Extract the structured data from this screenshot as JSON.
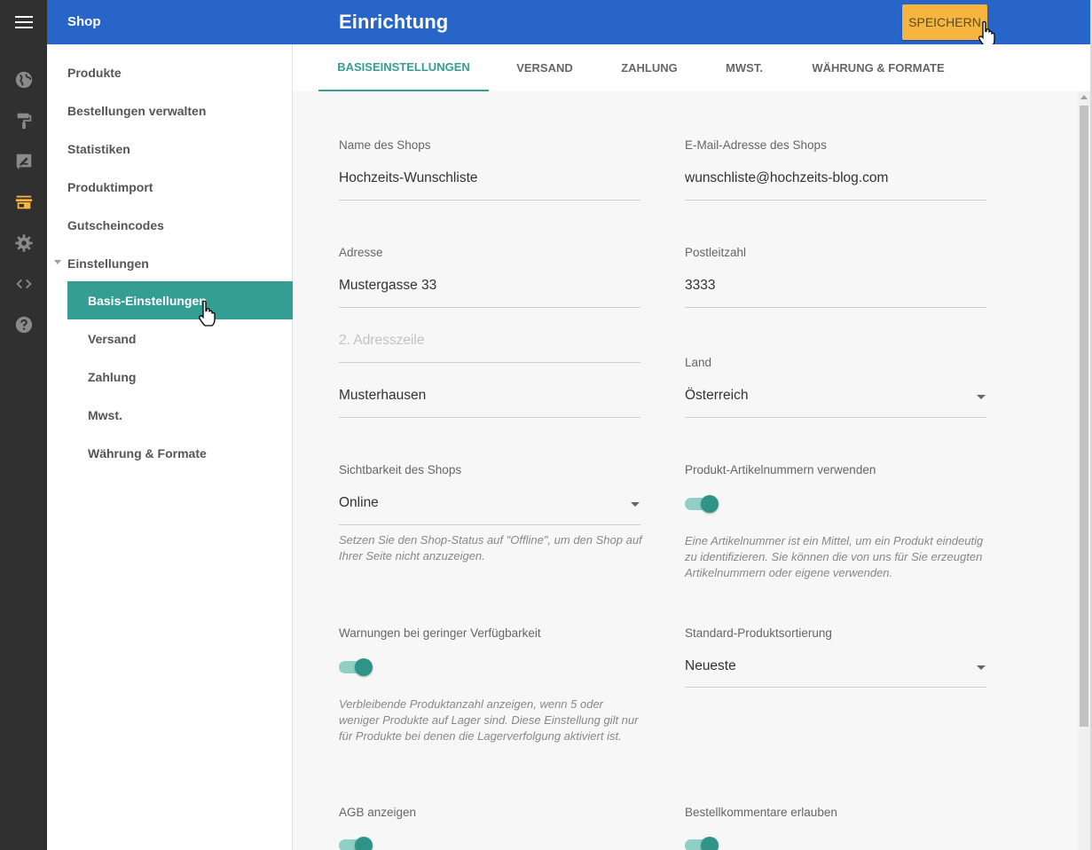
{
  "header": {
    "app_name": "Shop",
    "page_title": "Einrichtung",
    "save_label": "SPEICHERN"
  },
  "rail": {
    "icons": [
      "menu-icon",
      "globe-icon",
      "paint-roller-icon",
      "edit-post-icon",
      "store-icon",
      "gear-icon",
      "code-icon",
      "help-icon"
    ],
    "active_icon": "store-icon",
    "active_color": "#f5b53f"
  },
  "sidebar": {
    "items": [
      "Produkte",
      "Bestellungen verwalten",
      "Statistiken",
      "Produktimport",
      "Gutscheincodes"
    ],
    "group_label": "Einstellungen",
    "sub_items": [
      "Basis-Einstellungen",
      "Versand",
      "Zahlung",
      "Mwst.",
      "Währung & Formate"
    ],
    "active_sub_item": "Basis-Einstellungen"
  },
  "tabs": [
    "BASISEINSTELLUNGEN",
    "VERSAND",
    "ZAHLUNG",
    "MWST.",
    "WÄHRUNG & FORMATE"
  ],
  "active_tab": "BASISEINSTELLUNGEN",
  "form": {
    "shop_name": {
      "label": "Name des Shops",
      "value": "Hochzeits-Wunschliste"
    },
    "shop_email": {
      "label": "E-Mail-Adresse des Shops",
      "value": "wunschliste@hochzeits-blog.com"
    },
    "address": {
      "label": "Adresse",
      "value": "Mustergasse 33"
    },
    "postal_code": {
      "label": "Postleitzahl",
      "value": "3333"
    },
    "address_line2": {
      "placeholder": "2. Adresszeile"
    },
    "city": {
      "value": "Musterhausen"
    },
    "country": {
      "label": "Land",
      "value": "Österreich"
    },
    "visibility": {
      "label": "Sichtbarkeit des Shops",
      "value": "Online",
      "hint": "Setzen Sie den Shop-Status auf \"Offline\", um den Shop auf Ihrer Seite nicht anzuzeigen."
    },
    "sku": {
      "label": "Produkt-Artikelnummern verwenden",
      "enabled": true,
      "hint": "Eine Artikelnummer ist ein Mittel, um ein Produkt eindeutig zu identifizieren. Sie können die von uns für Sie erzeugten Artikelnummern oder eigene verwenden."
    },
    "low_stock": {
      "label": "Warnungen bei geringer Verfügbarkeit",
      "enabled": true,
      "hint": "Verbleibende Produktanzahl anzeigen, wenn 5 oder weniger Produkte auf Lager sind. Diese Einstellung gilt nur für Produkte bei denen die Lagerverfolgung aktiviert ist."
    },
    "sorting": {
      "label": "Standard-Produktsortierung",
      "value": "Neueste"
    },
    "terms": {
      "label": "AGB anzeigen",
      "enabled": true
    },
    "order_comments": {
      "label": "Bestellkommentare erlauben",
      "enabled": true
    }
  },
  "colors": {
    "header_blue": "#2765c8",
    "accent_teal": "#349e94",
    "save_button": "#f5b53f",
    "rail_dark": "#303030"
  }
}
